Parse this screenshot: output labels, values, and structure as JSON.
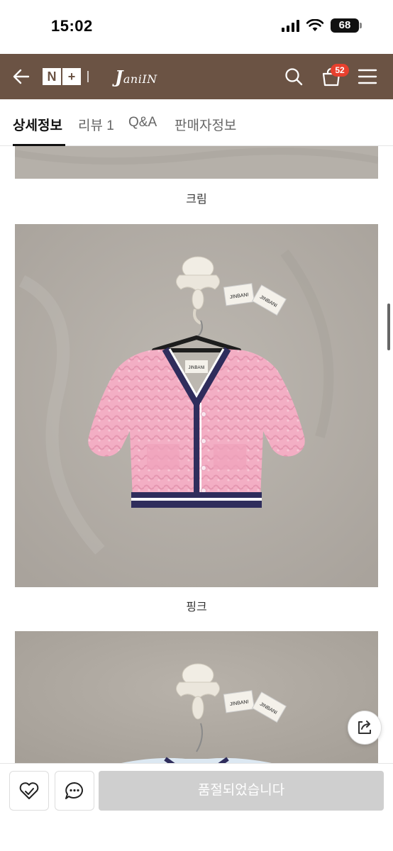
{
  "status_bar": {
    "time": "15:02",
    "battery": "68"
  },
  "header": {
    "logo_n": "N",
    "logo_plus": "+",
    "shop_logo_lead": "J",
    "shop_logo_rest": "ani",
    "shop_logo_tail": "IN",
    "cart_count": "52",
    "bg_color": "#6b5344"
  },
  "tabs": [
    {
      "label": "상세정보",
      "active": true
    },
    {
      "label": "리뷰 1",
      "active": false
    },
    {
      "label": "Q&A",
      "active": false
    },
    {
      "label": "판매자정보",
      "active": false
    }
  ],
  "content": {
    "captions": [
      "크림",
      "핑크"
    ],
    "tag_text": "JINBANI"
  },
  "bottom_bar": {
    "soldout_label": "품절되었습니다"
  }
}
